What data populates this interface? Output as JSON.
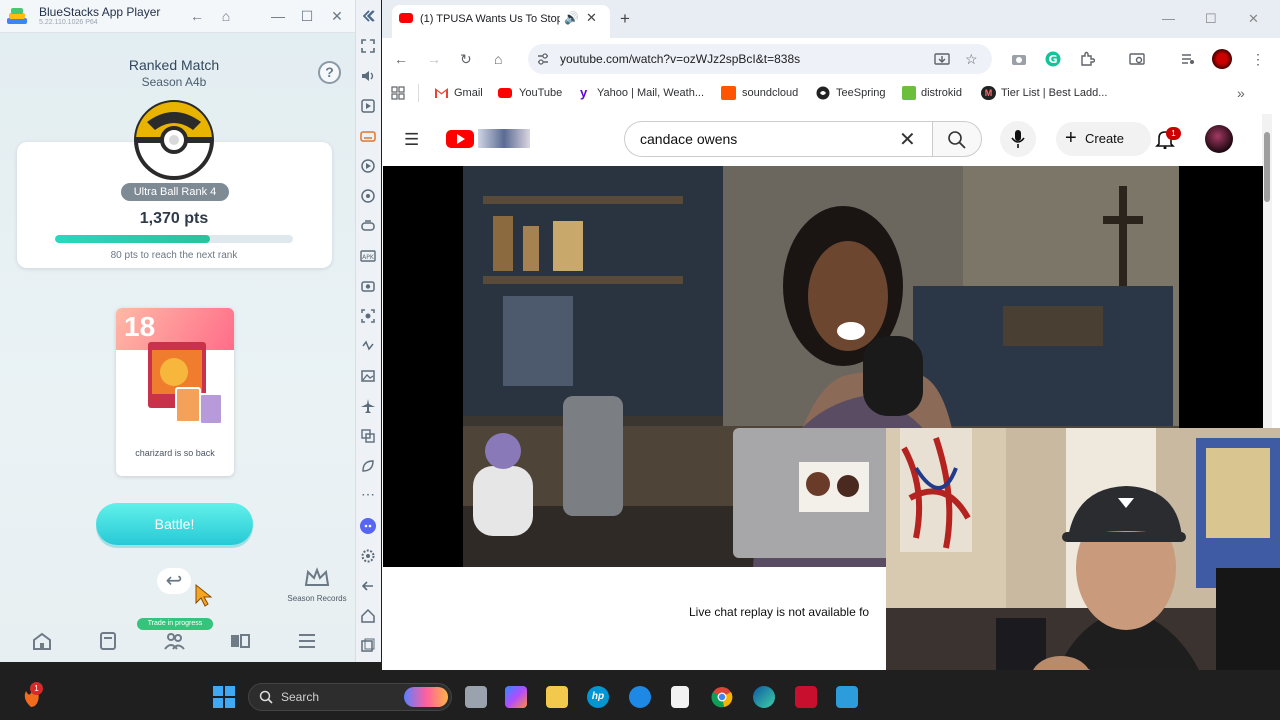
{
  "bluestacks": {
    "title": "BlueStacks App Player",
    "version": "5.22.110.1026  P64",
    "game": {
      "title": "Ranked Match",
      "season": "Season A4b",
      "rank": "Ultra Ball Rank 4",
      "points": "1,370 pts",
      "progress": 0.65,
      "next_rank": "80 pts to reach the next rank",
      "deck": {
        "number": "18",
        "name": "charizard is so back"
      },
      "battle": "Battle!",
      "trade_label": "Trade in progress",
      "season_records": "Season Records"
    }
  },
  "chrome": {
    "tab_title": "(1) TPUSA Wants Us To Stop",
    "url": "youtube.com/watch?v=ozWJz2spBcI&t=838s",
    "bookmarks": [
      "Gmail",
      "YouTube",
      "Yahoo | Mail, Weath...",
      "soundcloud",
      "TeeSpring",
      "distrokid",
      "Tier List | Best Ladd..."
    ]
  },
  "youtube": {
    "search_query": "candace owens",
    "create_label": "Create",
    "notifications": "1",
    "chat_note": "Live chat replay is not available fo"
  },
  "taskbar": {
    "search_label": "Search",
    "badge": "1"
  },
  "colors": {
    "accent": "#27c9d6",
    "youtube_red": "#ff0000",
    "progress": "#2bd6c0",
    "trade": "#35c47b"
  }
}
